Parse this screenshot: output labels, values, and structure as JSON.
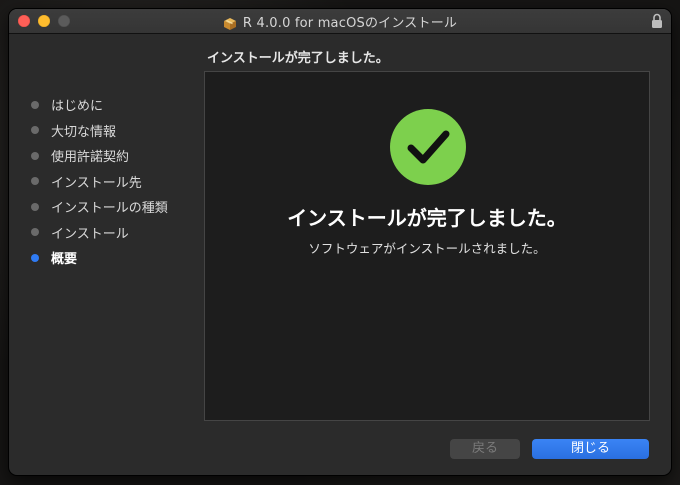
{
  "window": {
    "title": "R 4.0.0 for macOSのインストール",
    "icons": {
      "app": "package-icon",
      "lock": "lock-icon"
    }
  },
  "heading": "インストールが完了しました。",
  "sidebar": {
    "items": [
      {
        "label": "はじめに"
      },
      {
        "label": "大切な情報"
      },
      {
        "label": "使用許諾契約"
      },
      {
        "label": "インストール先"
      },
      {
        "label": "インストールの種類"
      },
      {
        "label": "インストール"
      },
      {
        "label": "概要",
        "current": true
      }
    ]
  },
  "content": {
    "title": "インストールが完了しました。",
    "message": "ソフトウェアがインストールされました。",
    "icon": "checkmark-icon"
  },
  "buttons": {
    "back": "戻る",
    "close": "閉じる"
  },
  "colors": {
    "accent": "#2f7bf4",
    "success": "#7dd04d",
    "traffic_close": "#fe5f57",
    "traffic_minimize": "#febc2e"
  }
}
